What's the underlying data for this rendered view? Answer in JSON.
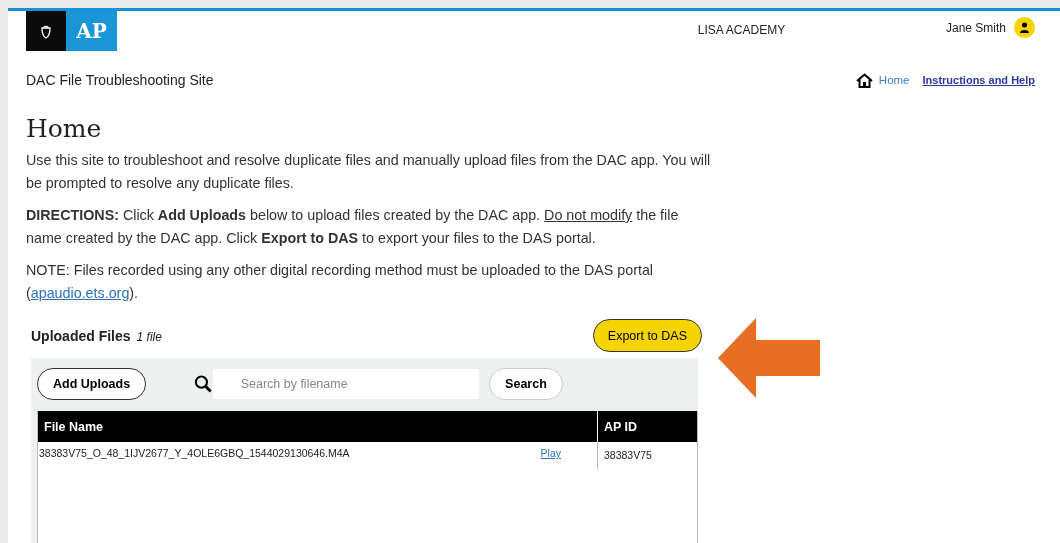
{
  "header": {
    "logo": {
      "text": "AP"
    },
    "school": "LISA ACADEMY",
    "user": "Jane Smith"
  },
  "subheader": {
    "site_title": "DAC File Troubleshooting Site",
    "nav": [
      {
        "label": "Home",
        "kind": "home"
      },
      {
        "label": "Instructions and Help",
        "kind": "link"
      }
    ]
  },
  "page": {
    "heading": "Home",
    "intro": "Use this site to troubleshoot and resolve duplicate files and manually upload files from the DAC app. You will be prompted to resolve any duplicate files.",
    "directions": {
      "before": "**DIRECTIONS:** Click **Add Uploads** below to upload files created by the DAC app. ",
      "underlined": "Do not modify",
      "after": " the file name created by the DAC app. Click **Export to DAS** to export your files to the DAS portal."
    },
    "note": {
      "before": "NOTE: Files recorded using any other digital recording method must be uploaded to the DAS portal (",
      "link": "apaudio.ets.org",
      "after": ")."
    }
  },
  "uploads": {
    "title": "Uploaded Files",
    "count": "1 file",
    "export_button": "Export to DAS",
    "add_button": "Add Uploads",
    "search": {
      "placeholder": "Search by filename"
    },
    "search_button": "Search",
    "table": {
      "columns": [
        "File Name",
        "AP ID"
      ],
      "rows": [
        {
          "file_name": "38383V75_O_48_1IJV2677_Y_4OLE6GBQ_1544029130646.M4A",
          "action": "Play",
          "ap_id": "38383V75"
        }
      ]
    }
  }
}
